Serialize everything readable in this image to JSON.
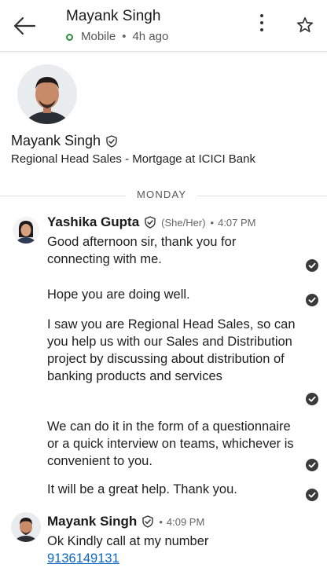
{
  "header": {
    "name": "Mayank Singh",
    "status": "Mobile",
    "last_seen": "4h ago",
    "icons": {
      "back": "arrow-left-icon",
      "more": "more-vertical-icon",
      "star": "star-outline-icon"
    }
  },
  "profile": {
    "name": "Mayank Singh",
    "headline": "Regional Head Sales - Mortgage at ICICI Bank"
  },
  "day_divider": "MONDAY",
  "messages": [
    {
      "sender": "Yashika Gupta",
      "pronouns": "(She/Her)",
      "time": "4:07 PM",
      "paragraphs": [
        "Good afternoon sir, thank you for connecting with me.",
        "Hope you are doing well.",
        "I saw you are Regional Head Sales, so can you help us with our Sales and Distribution project by discussing about distribution of banking products and services",
        "We can do it in the form of a questionnaire or a quick interview on teams, whichever is convenient to you.",
        "It will be a great help. Thank you."
      ]
    },
    {
      "sender": "Mayank Singh",
      "time": "4:09 PM",
      "text": "Ok Kindly call at my number",
      "phone": "9136149131"
    }
  ],
  "colors": {
    "accent_link": "#0a66c2",
    "online": "#2e8b3c",
    "read_receipt": "#3a3a3a"
  }
}
